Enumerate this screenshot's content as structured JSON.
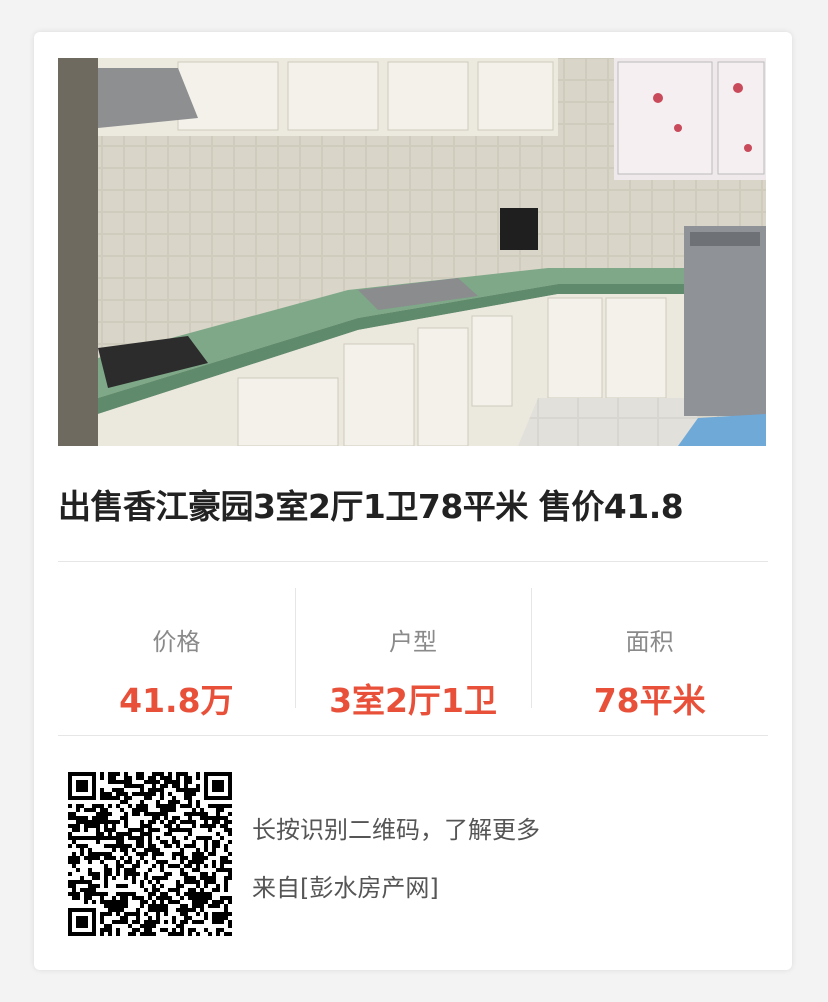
{
  "listing": {
    "title": "出售香江豪园3室2厅1卫78平米 售价41.8",
    "photo_alt": "kitchen"
  },
  "stats": [
    {
      "label": "价格",
      "value": "41.8万"
    },
    {
      "label": "户型",
      "value": "3室2厅1卫"
    },
    {
      "label": "面积",
      "value": "78平米"
    }
  ],
  "footer": {
    "qr_hint": "长按识别二维码，了解更多",
    "source": "来自[彭水房产网]"
  },
  "colors": {
    "accent": "#e8503a",
    "title": "#222222",
    "label": "#8a8a8a"
  }
}
